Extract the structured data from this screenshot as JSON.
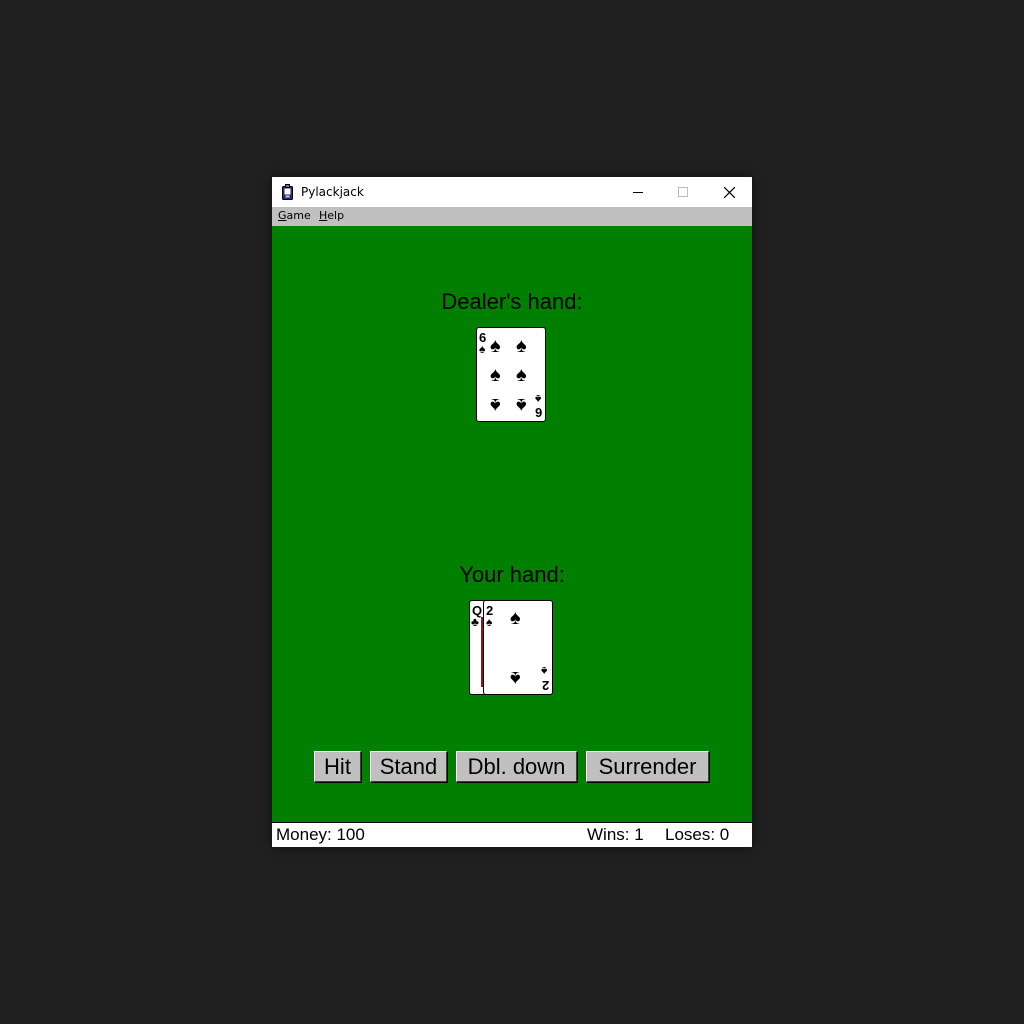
{
  "window": {
    "title": "Pylackjack",
    "minimize_glyph": "—",
    "maximize_glyph": "☐",
    "close_glyph": "✕"
  },
  "menu": {
    "game": {
      "accel": "G",
      "rest": "ame"
    },
    "help": {
      "accel": "H",
      "rest": "elp"
    }
  },
  "table": {
    "color": "#007f00",
    "dealer_label": "Dealer's hand:",
    "player_label": "Your hand:"
  },
  "dealer_cards": [
    {
      "rank": "6",
      "suit": "♠",
      "suit_name": "spades"
    }
  ],
  "player_cards": [
    {
      "rank": "Q",
      "suit": "♣",
      "suit_name": "clubs"
    },
    {
      "rank": "2",
      "suit": "♠",
      "suit_name": "spades"
    }
  ],
  "buttons": {
    "hit": "Hit",
    "stand": "Stand",
    "double_down": "Dbl. down",
    "surrender": "Surrender"
  },
  "status": {
    "money": "Money: 100",
    "wins": "Wins: 1",
    "loses": "Loses: 0"
  }
}
